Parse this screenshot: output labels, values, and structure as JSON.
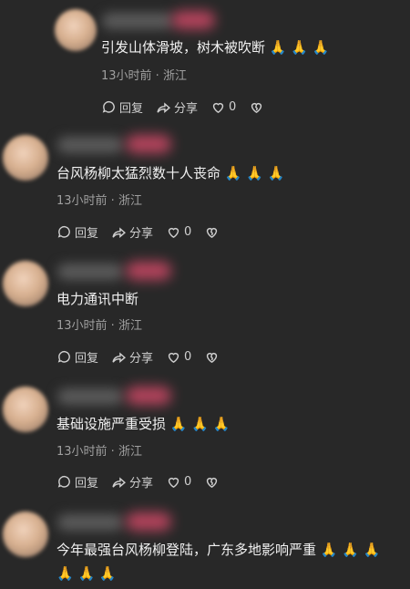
{
  "comments": [
    {
      "text": "引发山体滑坡，树木被吹断 🙏 🙏 🙏",
      "meta": "13小时前 · 浙江",
      "reply_label": "回复",
      "share_label": "分享",
      "likes": "0"
    },
    {
      "text": "台风杨柳太猛烈数十人丧命 🙏 🙏 🙏",
      "meta": "13小时前 · 浙江",
      "reply_label": "回复",
      "share_label": "分享",
      "likes": "0"
    },
    {
      "text": "电力通讯中断",
      "meta": "13小时前 · 浙江",
      "reply_label": "回复",
      "share_label": "分享",
      "likes": "0"
    },
    {
      "text": "基础设施严重受损 🙏 🙏 🙏",
      "meta": "13小时前 · 浙江",
      "reply_label": "回复",
      "share_label": "分享",
      "likes": "0"
    },
    {
      "text_line1": "今年最强台风杨柳登陆，广东多地影响严重 🙏 🙏 🙏",
      "text_line2": "🙏 🙏 🙏"
    }
  ]
}
